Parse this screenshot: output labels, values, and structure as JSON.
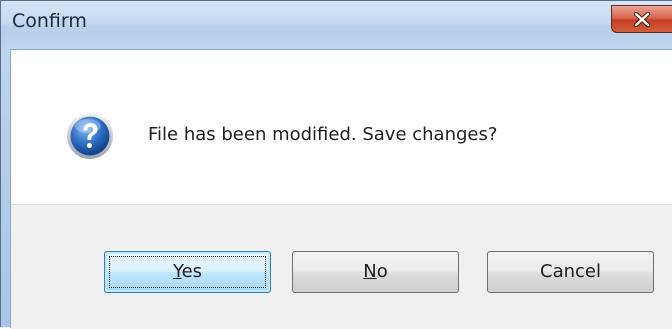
{
  "window": {
    "title": "Confirm"
  },
  "message": {
    "text": "File has been modified. Save changes?",
    "icon": "question-icon"
  },
  "buttons": {
    "yes": {
      "mnemonic": "Y",
      "rest": "es"
    },
    "no": {
      "mnemonic": "N",
      "rest": "o"
    },
    "cancel": {
      "label": "Cancel"
    }
  },
  "colors": {
    "titlebar": "#c4d9f0",
    "close_button": "#c23e24",
    "default_button_border": "#3c7fb1",
    "footer": "#f0f0f0"
  }
}
